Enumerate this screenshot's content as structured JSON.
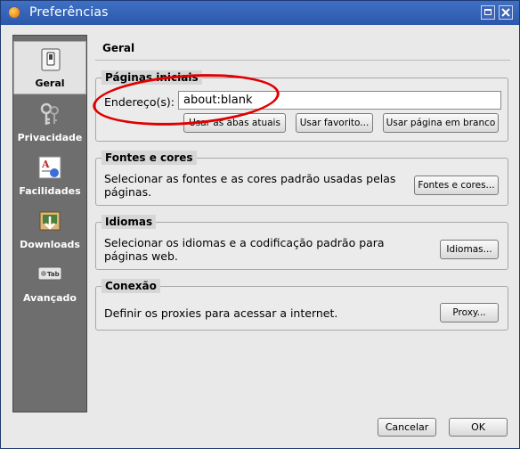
{
  "window": {
    "title": "Preferências",
    "controls": [
      "maximize",
      "close"
    ]
  },
  "sidebar": {
    "items": [
      {
        "label": "Geral",
        "icon": "switch-icon",
        "selected": true
      },
      {
        "label": "Privacidade",
        "icon": "keys-icon",
        "selected": false
      },
      {
        "label": "Facilidades",
        "icon": "font-document-icon",
        "selected": false
      },
      {
        "label": "Downloads",
        "icon": "downloads-icon",
        "selected": false
      },
      {
        "label": "Avançado",
        "icon": "tab-icon",
        "selected": false
      }
    ]
  },
  "page": {
    "title": "Geral"
  },
  "homepage": {
    "legend": "Páginas iniciais",
    "address_label": "Endereço(s):",
    "address_value": "about:blank",
    "btn_current": "Usar as abas atuais",
    "btn_bookmark": "Usar favorito...",
    "btn_blank": "Usar página em branco"
  },
  "fonts": {
    "legend": "Fontes e cores",
    "desc": "Selecionar as fontes e as cores padrão usadas pelas páginas.",
    "button": "Fontes e cores..."
  },
  "languages": {
    "legend": "Idiomas",
    "desc": "Selecionar os idiomas e a codificação padrão para páginas web.",
    "button": "Idiomas..."
  },
  "connection": {
    "legend": "Conexão",
    "desc": "Definir os proxies para acessar a internet.",
    "button": "Proxy..."
  },
  "footer": {
    "cancel": "Cancelar",
    "ok": "OK"
  },
  "colors": {
    "titlebar": "#2b58aa",
    "sidebar": "#6e6e6e",
    "annotation": "#e00000"
  }
}
